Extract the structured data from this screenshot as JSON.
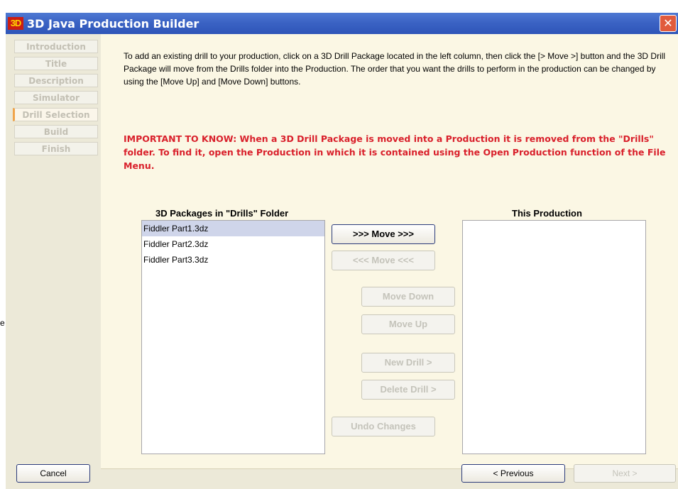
{
  "window": {
    "app_icon_text": "3D",
    "title": "3D Java Production Builder",
    "close_glyph": "✕",
    "stray_text": "e"
  },
  "sidebar": {
    "steps": [
      {
        "label": "Introduction"
      },
      {
        "label": "Title"
      },
      {
        "label": "Description"
      },
      {
        "label": "Simulator"
      },
      {
        "label": "Drill Selection",
        "active": true
      },
      {
        "label": "Build"
      },
      {
        "label": "Finish"
      }
    ]
  },
  "main": {
    "instructions": "To add an existing drill to your production, click on a 3D Drill Package located in the left column, then click the [> Move >] button and the 3D Drill Package will move from the Drills folder into the Production.  The order that you want the drills to perform in the production can be changed by using the [Move Up] and [Move Down] buttons.",
    "important": "IMPORTANT TO KNOW:  When a 3D Drill Package is moved into a Production it is removed from the \"Drills\" folder.  To find it, open the Production in which it is contained using the Open Production function of the File Menu.",
    "drills_header": "3D Packages in \"Drills\" Folder",
    "production_header": "This Production",
    "drills": [
      {
        "name": "Fiddler Part1.3dz",
        "selected": true
      },
      {
        "name": "Fiddler Part2.3dz"
      },
      {
        "name": "Fiddler Part3.3dz"
      }
    ],
    "production_items": [],
    "buttons": {
      "move_right": ">>> Move >>>",
      "move_left": "<<< Move <<<",
      "move_down": "Move Down",
      "move_up": "Move Up",
      "new_drill": "New Drill >",
      "delete_drill": "Delete Drill >",
      "undo_changes": "Undo Changes"
    }
  },
  "footer": {
    "cancel": "Cancel",
    "previous": "< Previous",
    "next": "Next >"
  },
  "colors": {
    "title_bar": "#3b63c4",
    "important_text": "#d9202b",
    "active_step_accent": "#f0a44a",
    "list_selection": "#cfd5ea"
  }
}
